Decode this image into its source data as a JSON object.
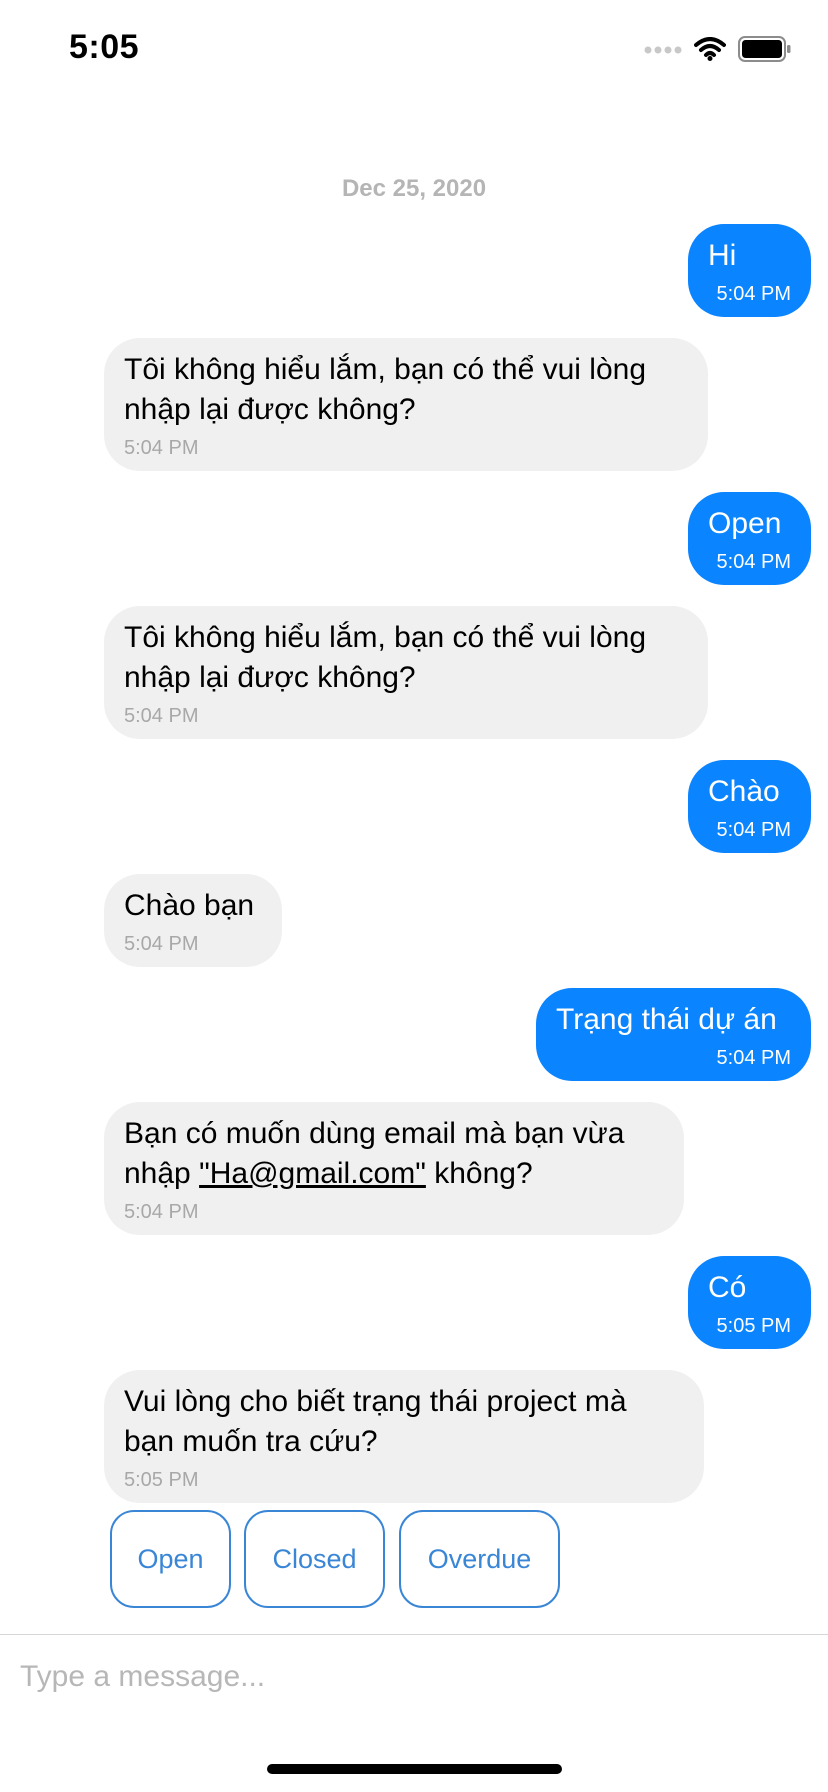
{
  "status_bar": {
    "time": "5:05",
    "icons": [
      "cellular-signal-icon",
      "wifi-icon",
      "battery-icon"
    ]
  },
  "colors": {
    "outgoing_bubble": "#0a84ff",
    "incoming_bubble": "#f0f0f0",
    "quick_reply_accent": "#3a86d6",
    "timestamp_gray": "#a8a8a8"
  },
  "chat": {
    "date": "Dec 25, 2020",
    "messages": [
      {
        "direction": "out",
        "text": "Hi",
        "time": "5:04 PM"
      },
      {
        "direction": "in",
        "text": "Tôi không hiểu lắm, bạn có thể vui lòng nhập lại được không?",
        "time": "5:04 PM"
      },
      {
        "direction": "out",
        "text": "Open",
        "time": "5:04 PM"
      },
      {
        "direction": "in",
        "text": "Tôi không hiểu lắm, bạn có thể vui lòng nhập lại được không?",
        "time": "5:04 PM"
      },
      {
        "direction": "out",
        "text": "Chào",
        "time": "5:04 PM"
      },
      {
        "direction": "in",
        "text": "Chào bạn",
        "time": "5:04 PM"
      },
      {
        "direction": "out",
        "text": "Trạng thái dự án",
        "time": "5:04 PM"
      },
      {
        "direction": "in",
        "text_before": "Bạn có muốn dùng email mà bạn vừa nhập ",
        "link": "\"Ha@gmail.com\"",
        "text_after": " không?",
        "time": "5:04 PM"
      },
      {
        "direction": "out",
        "text": "Có",
        "time": "5:05 PM"
      },
      {
        "direction": "in",
        "text": "Vui lòng cho biết trạng thái project mà bạn muốn tra cứu?",
        "time": "5:05 PM"
      }
    ]
  },
  "quick_replies": [
    "Open",
    "Closed",
    "Overdue"
  ],
  "composer": {
    "placeholder": "Type a message..."
  }
}
